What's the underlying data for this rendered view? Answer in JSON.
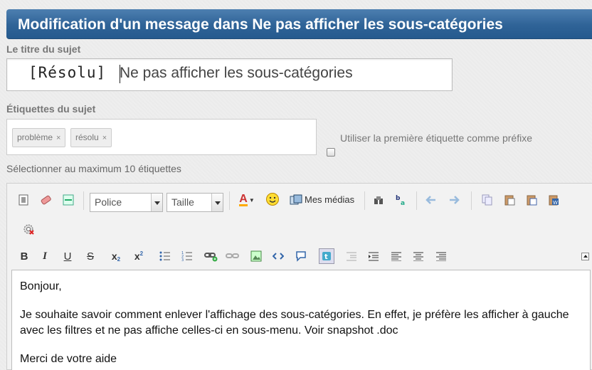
{
  "header": {
    "title": "Modification d'un message dans Ne pas afficher les sous-catégories"
  },
  "subject": {
    "label": "Le titre du sujet",
    "prefix": "[Résolu]",
    "value": "Ne pas afficher les sous-catégories"
  },
  "tags": {
    "label": "Étiquettes du sujet",
    "items": [
      {
        "text": "problème",
        "remove": "×"
      },
      {
        "text": "résolu",
        "remove": "×"
      }
    ],
    "prefix_option_label": "Utiliser la première étiquette comme préfixe",
    "prefix_option_checked": false,
    "hint": "Sélectionner au maximum 10 étiquettes"
  },
  "toolbar": {
    "font_select": "Police",
    "size_select": "Taille",
    "media_label": "Mes médias",
    "bold": "B",
    "italic": "I",
    "underline": "U",
    "strike": "S",
    "subscript": "x",
    "subscript_mark": "2",
    "superscript": "x",
    "superscript_mark": "2",
    "color_glyph": "A"
  },
  "body": {
    "paragraphs": [
      "Bonjour,",
      "Je souhaite savoir comment enlever l'affichage des sous-catégories. En effet, je préfère les afficher à gauche avec les filtres et ne pas affiche celles-ci en sous-menu. Voir snapshot .doc",
      "Merci de votre aide"
    ]
  }
}
